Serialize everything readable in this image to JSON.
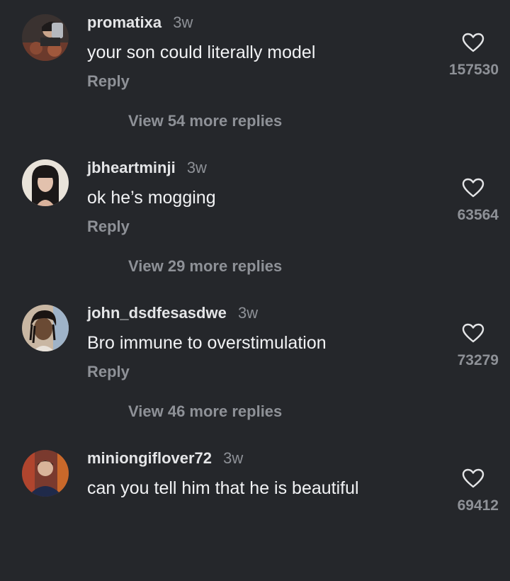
{
  "comments": [
    {
      "username": "promatixa",
      "time": "3w",
      "text": "your son could literally model",
      "reply_label": "Reply",
      "view_replies": "View 54 more replies",
      "likes": "157530"
    },
    {
      "username": "jbheartminji",
      "time": "3w",
      "text": "ok he’s mogging",
      "reply_label": "Reply",
      "view_replies": "View 29 more replies",
      "likes": "63564"
    },
    {
      "username": "john_dsdfesasdwe",
      "time": "3w",
      "text": "Bro immune to overstimulation",
      "reply_label": "Reply",
      "view_replies": "View 46 more replies",
      "likes": "73279"
    },
    {
      "username": "miniongiflover72",
      "time": "3w",
      "text": "can you tell him that he is beautiful",
      "likes": "69412"
    }
  ],
  "icons": {
    "like": "heart-outline-icon"
  },
  "colors": {
    "background": "#25272b",
    "primary_text": "#f1f2f4",
    "secondary_text": "#8e9197"
  }
}
